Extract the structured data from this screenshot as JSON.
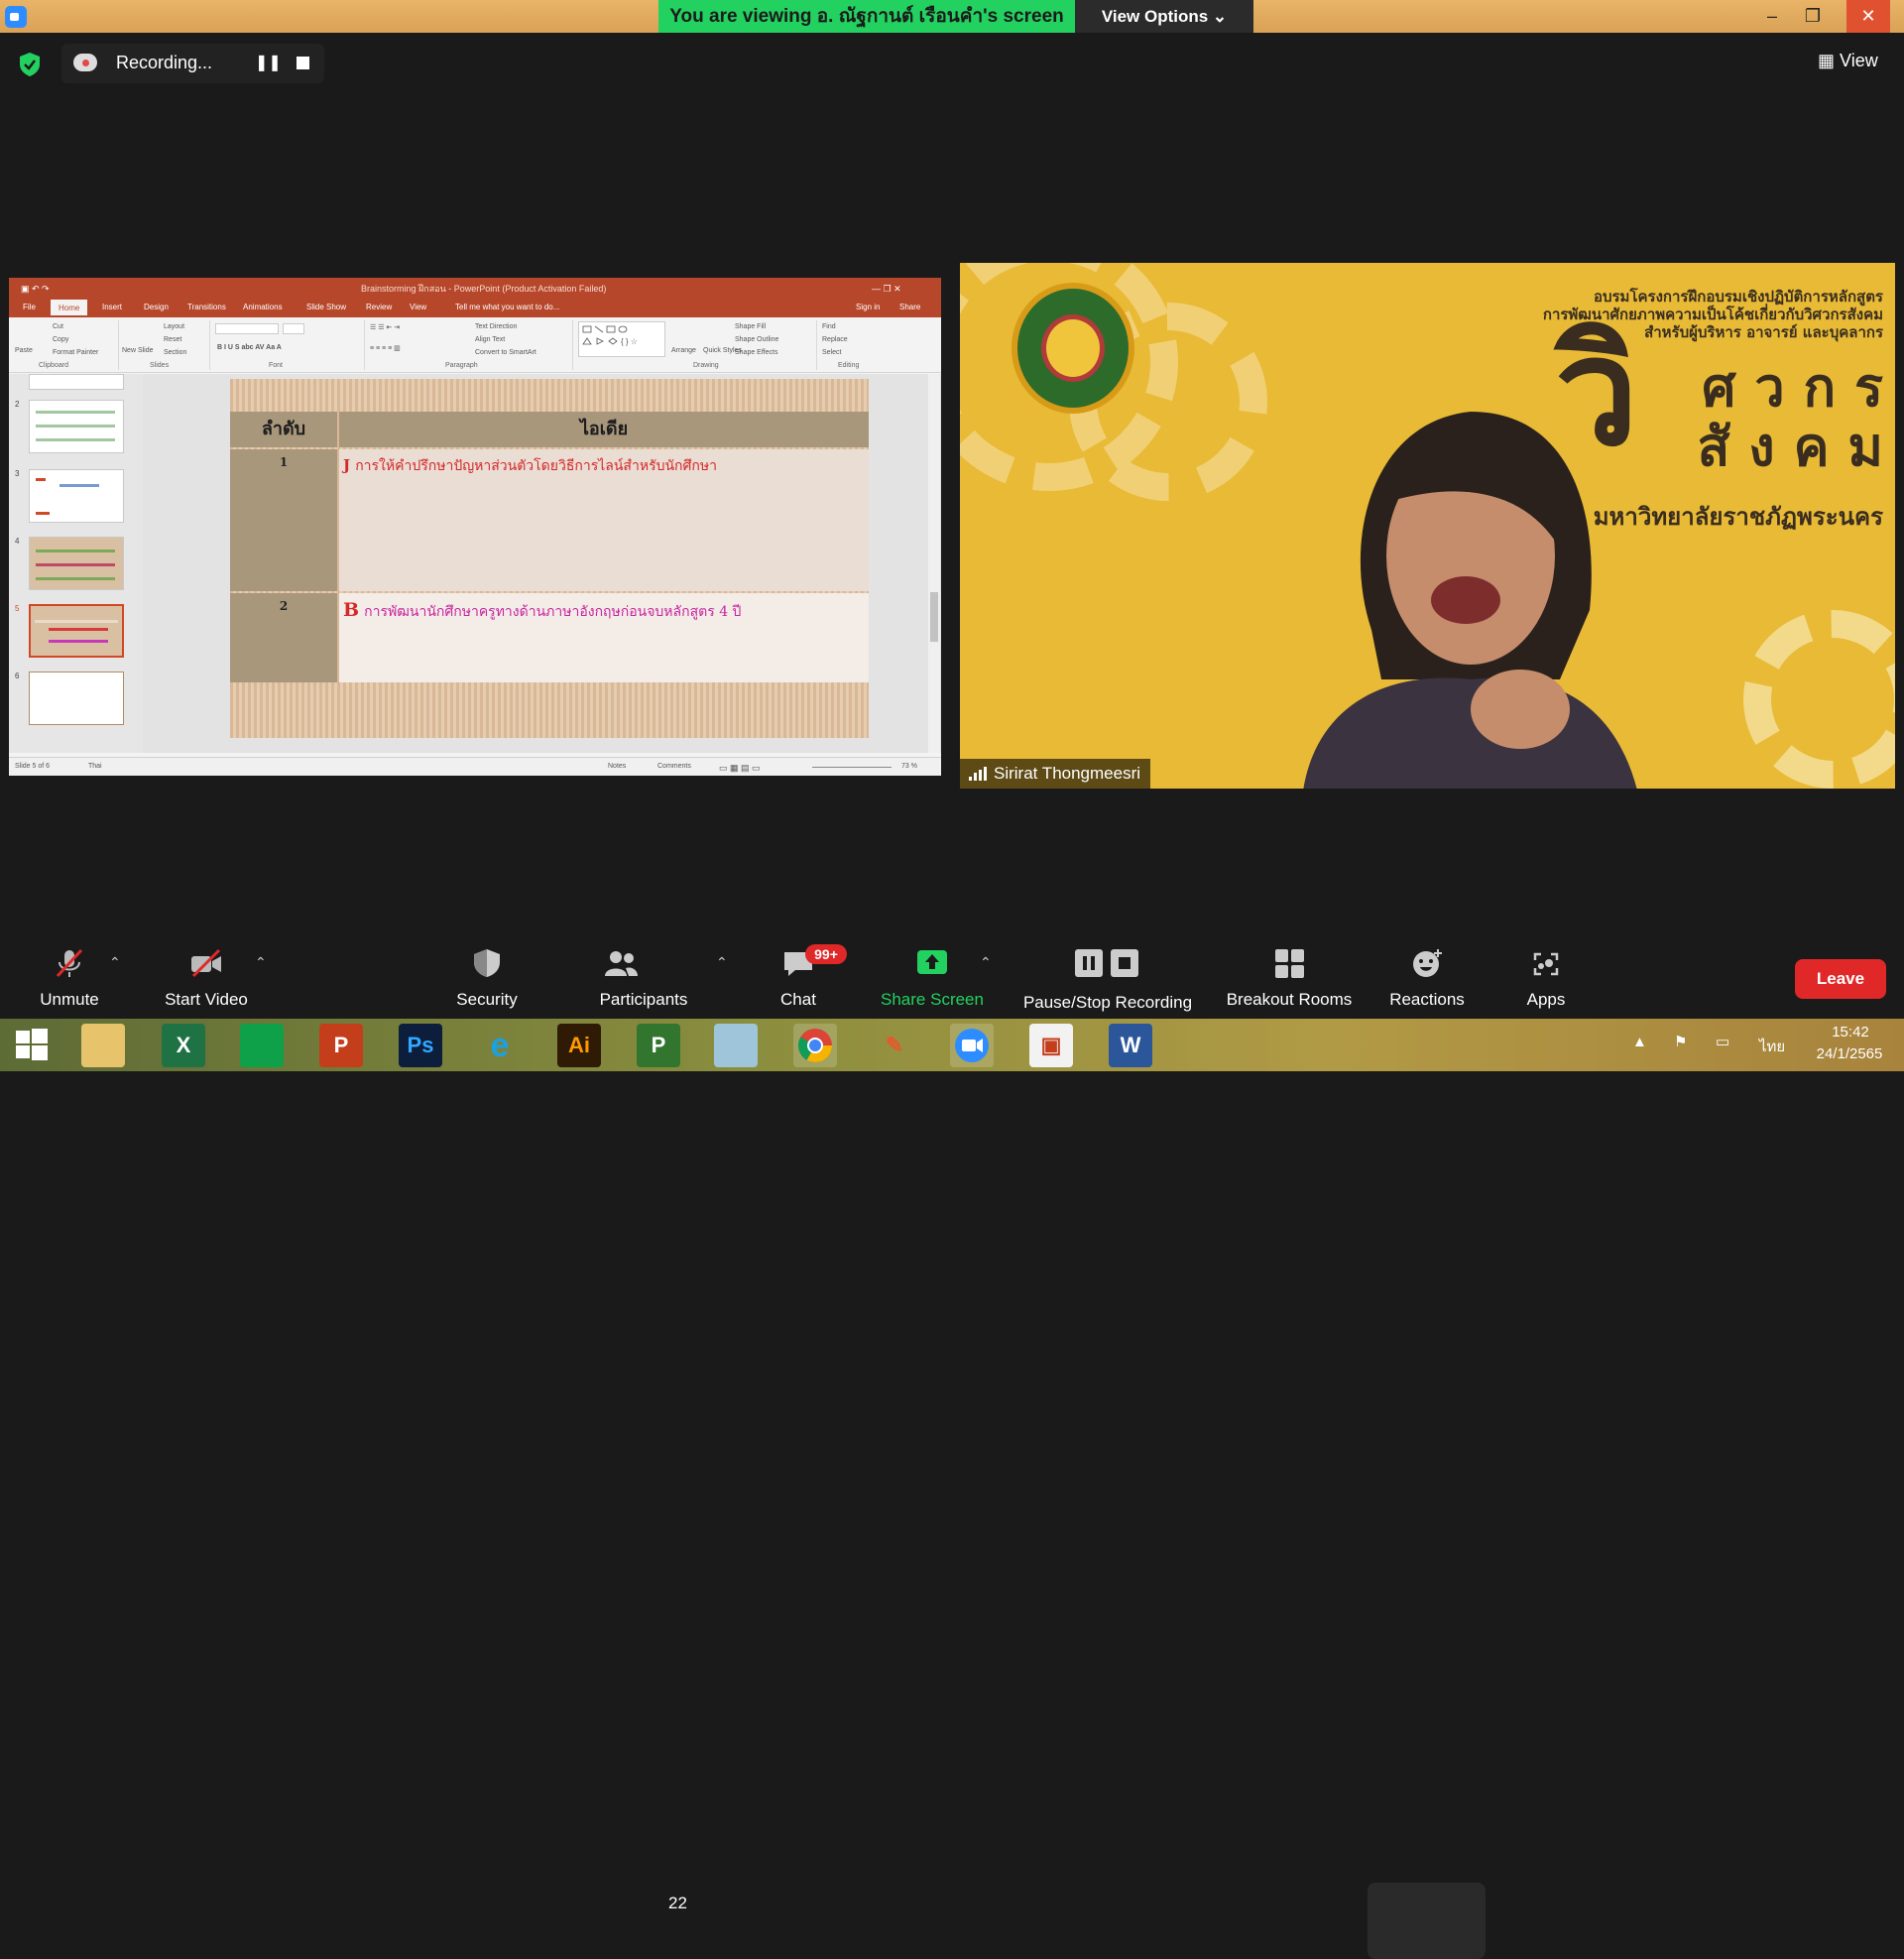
{
  "titlebar": {
    "viewing_banner": "You are viewing อ. ณัฐกานต์ เรือนคำ's screen",
    "view_options": "View Options ⌄",
    "minimize": "–",
    "restore": "❐",
    "close": "✕"
  },
  "recording": {
    "label": "Recording...",
    "pause_glyph": "❚❚"
  },
  "view_button": "▦ View",
  "ppt": {
    "window_title": "Brainstorming ฝึกสอน - PowerPoint (Product Activation Failed)",
    "sign_in": "Sign in",
    "share": "Share",
    "tabs": [
      "File",
      "Home",
      "Insert",
      "Design",
      "Transitions",
      "Animations",
      "Slide Show",
      "Review",
      "View",
      "Tell me what you want to do..."
    ],
    "ribbon_groups": [
      "Clipboard",
      "Slides",
      "Font",
      "Paragraph",
      "Drawing",
      "Editing"
    ],
    "ribbon_items": {
      "paste": "Paste",
      "cut": "Cut",
      "copy": "Copy",
      "format_painter": "Format Painter",
      "new_slide": "New Slide",
      "layout": "Layout",
      "reset": "Reset",
      "section": "Section",
      "text_direction": "Text Direction",
      "align_text": "Align Text",
      "convert_smartart": "Convert to SmartArt",
      "arrange": "Arrange",
      "quick_styles": "Quick Styles",
      "shape_fill": "Shape Fill",
      "shape_outline": "Shape Outline",
      "shape_effects": "Shape Effects",
      "find": "Find",
      "replace": "Replace",
      "select": "Select"
    },
    "thumb_numbers": [
      "2",
      "3",
      "4",
      "5",
      "6"
    ],
    "slide": {
      "col1": "ลำดับ",
      "col2": "ไอเดีย",
      "rows": [
        {
          "num": "1",
          "prefix": "J",
          "text": "การให้คำปรึกษาปัญหาส่วนตัวโดยวิธีการไลน์สำหรับนักศึกษา"
        },
        {
          "num": "2",
          "prefix": "B",
          "text": "การพัฒนานักศึกษาครูทางด้านภาษาอังกฤษก่อนจบหลักสูตร 4 ปี"
        }
      ]
    },
    "status": {
      "slide_of": "Slide 5 of 6",
      "language": "Thai",
      "notes": "Notes",
      "comments": "Comments",
      "zoom": "73 %"
    }
  },
  "video": {
    "banner_line1": "อบรมโครงการฝึกอบรมเชิงปฏิบัติการหลักสูตร",
    "banner_line2": "การพัฒนาศักยภาพความเป็นโค้ชเกี่ยวกับวิศวกรสังคม",
    "banner_line3": "สำหรับผู้บริหาร อาจารย์ และบุคลากร",
    "big_letter": "วิ",
    "big_word1": "ศ ว ก ร",
    "big_word2": "สั ง ค ม",
    "university": "มหาวิทยาลัยราชภัฏพระนคร",
    "participant_name": "Sirirat Thongmeesri"
  },
  "toolbar": {
    "unmute": "Unmute",
    "start_video": "Start Video",
    "security": "Security",
    "participants": "Participants",
    "participants_count": "22",
    "chat": "Chat",
    "chat_badge": "99+",
    "share_screen": "Share Screen",
    "pause_stop": "Pause/Stop Recording",
    "breakout": "Breakout Rooms",
    "reactions": "Reactions",
    "apps": "Apps",
    "leave": "Leave",
    "caret": "⌃"
  },
  "taskbar": {
    "apps": [
      "Start",
      "File Explorer",
      "Excel",
      "Store",
      "PowerPoint",
      "Photoshop",
      "Internet Explorer",
      "Illustrator",
      "Project",
      "Notepad",
      "Chrome",
      "Paint",
      "Zoom",
      "PowerPoint Viewer",
      "Word"
    ],
    "excel": "X",
    "ps": "Ps",
    "ai": "Ai",
    "pptx": "P",
    "proj": "P",
    "word": "W",
    "lang": "ไทย",
    "time": "15:42",
    "date": "24/1/2565"
  },
  "colors": {
    "zoom_green": "#23d160",
    "ppt_red": "#b7472a",
    "leave_red": "#e02828",
    "badge_red": "#e02828"
  }
}
